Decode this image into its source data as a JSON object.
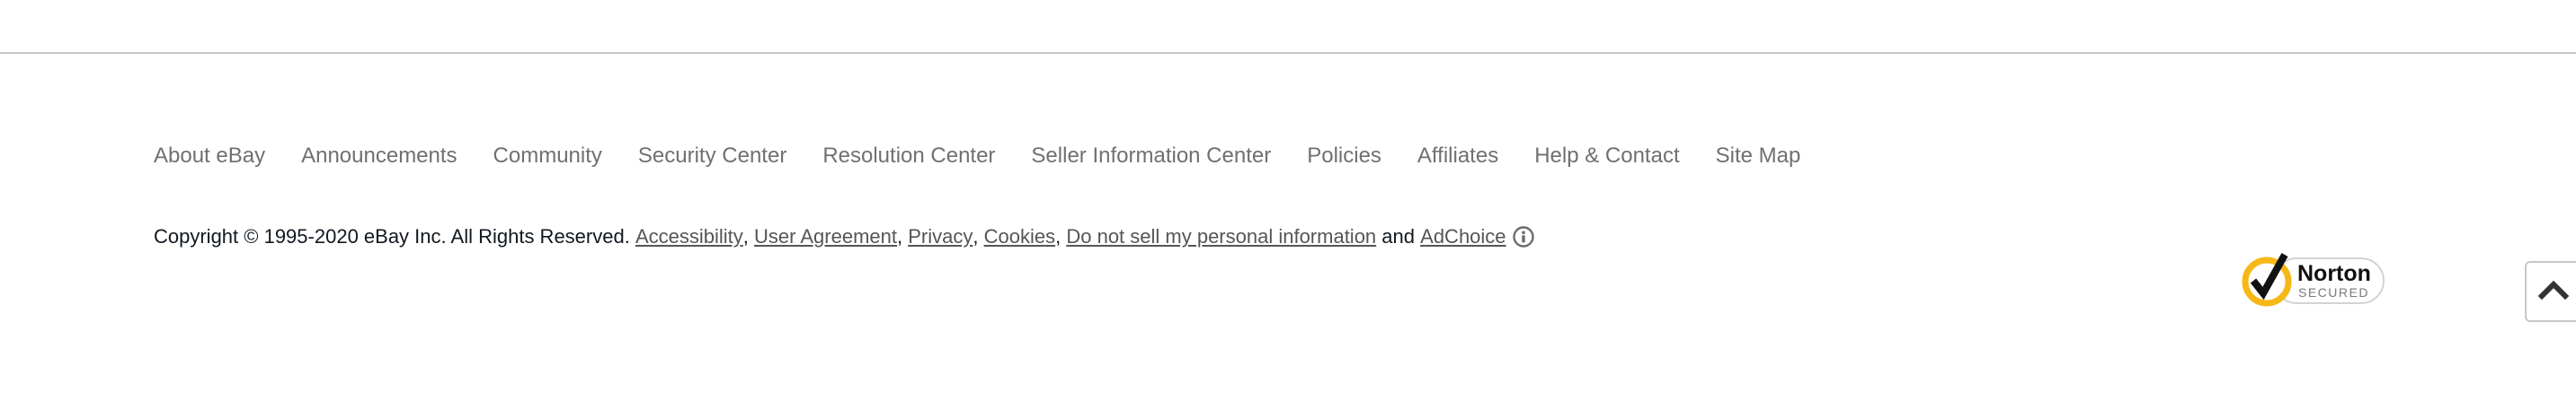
{
  "footer": {
    "nav_links": [
      "About eBay",
      "Announcements",
      "Community",
      "Security Center",
      "Resolution Center",
      "Seller Information Center",
      "Policies",
      "Affiliates",
      "Help & Contact",
      "Site Map"
    ],
    "copyright_text": "Copyright © 1995-2020 eBay Inc. All Rights Reserved.",
    "legal_links": {
      "accessibility": "Accessibility",
      "user_agreement": "User Agreement",
      "privacy": "Privacy",
      "cookies": "Cookies",
      "do_not_sell": "Do not sell my personal information",
      "conjunction": "and",
      "adchoice": "AdChoice"
    },
    "separator": ",",
    "adchoice_icon": "adchoice-info-icon",
    "norton_badge": {
      "title": "Norton",
      "subtitle": "SECURED"
    },
    "scroll_top_icon": "chevron-up-icon"
  },
  "colors": {
    "link_gray": "#707070",
    "text_dark": "#111820",
    "norton_yellow": "#f6b817",
    "divider": "#c7c7c7"
  }
}
